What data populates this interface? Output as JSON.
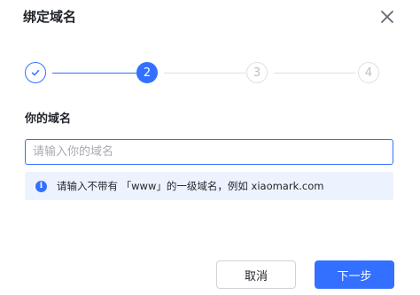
{
  "dialog": {
    "title": "绑定域名",
    "close_icon": "close-icon"
  },
  "stepper": {
    "steps": [
      {
        "label": "",
        "state": "done",
        "icon": "check-icon"
      },
      {
        "label": "2",
        "state": "active"
      },
      {
        "label": "3",
        "state": "todo"
      },
      {
        "label": "4",
        "state": "todo"
      }
    ]
  },
  "form": {
    "label": "你的域名",
    "input_value": "",
    "input_placeholder": "请输入你的域名"
  },
  "hint": {
    "icon": "info-icon",
    "text": "请输入不带有 「www」的一级域名，例如 xiaomark.com"
  },
  "footer": {
    "cancel_label": "取消",
    "next_label": "下一步"
  },
  "colors": {
    "accent": "#3370ff",
    "hint_bg": "#edf3fe",
    "inactive": "#dee0e3"
  }
}
